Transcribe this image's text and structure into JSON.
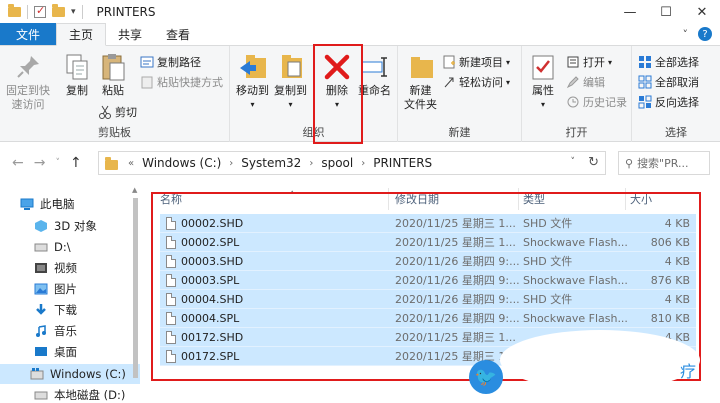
{
  "window": {
    "title": "PRINTERS",
    "controls": {
      "minimize": "—",
      "maximize": "☐",
      "close": "✕"
    }
  },
  "ribbon_tabs": [
    {
      "label": "文件"
    },
    {
      "label": "主页"
    },
    {
      "label": "共享"
    },
    {
      "label": "查看"
    }
  ],
  "ribbon": {
    "clipboard": {
      "label": "剪贴板",
      "pin": "固定到快\n速访问",
      "copy": "复制",
      "paste": "粘贴",
      "copy_path": "复制路径",
      "paste_shortcut": "粘贴快捷方式",
      "cut": "剪切"
    },
    "organize": {
      "label": "组织",
      "move_to": "移动到",
      "copy_to": "复制到",
      "delete": "删除",
      "rename": "重命名"
    },
    "new": {
      "label": "新建",
      "new_folder": "新建\n文件夹",
      "new_item": "新建项目",
      "easy_access": "轻松访问"
    },
    "open": {
      "label": "打开",
      "properties": "属性",
      "open": "打开",
      "edit": "编辑",
      "history": "历史记录"
    },
    "select": {
      "label": "选择",
      "select_all": "全部选择",
      "select_none": "全部取消",
      "invert": "反向选择"
    }
  },
  "address": {
    "prefix": "«",
    "crumbs": [
      "Windows (C:)",
      "System32",
      "spool",
      "PRINTERS"
    ],
    "search_placeholder": "搜索\"PR..."
  },
  "nav_pane": [
    {
      "label": "此电脑",
      "icon": "computer-icon"
    },
    {
      "label": "3D 对象",
      "icon": "cube-icon"
    },
    {
      "label": "D:\\",
      "icon": "drive-icon"
    },
    {
      "label": "视频",
      "icon": "video-icon"
    },
    {
      "label": "图片",
      "icon": "picture-icon"
    },
    {
      "label": "下载",
      "icon": "download-icon"
    },
    {
      "label": "音乐",
      "icon": "music-icon"
    },
    {
      "label": "桌面",
      "icon": "desktop-icon"
    },
    {
      "label": "Windows (C:)",
      "icon": "windows-drive-icon"
    },
    {
      "label": "本地磁盘 (D:)",
      "icon": "drive-icon"
    }
  ],
  "columns": {
    "name": "名称",
    "date": "修改日期",
    "type": "类型",
    "size": "大小"
  },
  "files": [
    {
      "name": "00002.SHD",
      "date": "2020/11/25 星期三 1...",
      "type": "SHD 文件",
      "size": "4 KB"
    },
    {
      "name": "00002.SPL",
      "date": "2020/11/25 星期三 1...",
      "type": "Shockwave Flash...",
      "size": "806 KB"
    },
    {
      "name": "00003.SHD",
      "date": "2020/11/26 星期四 9:...",
      "type": "SHD 文件",
      "size": "4 KB"
    },
    {
      "name": "00003.SPL",
      "date": "2020/11/26 星期四 9:...",
      "type": "Shockwave Flash...",
      "size": "876 KB"
    },
    {
      "name": "00004.SHD",
      "date": "2020/11/26 星期四 9:...",
      "type": "SHD 文件",
      "size": "4 KB"
    },
    {
      "name": "00004.SPL",
      "date": "2020/11/26 星期四 9:...",
      "type": "Shockwave Flash...",
      "size": "810 KB"
    },
    {
      "name": "00172.SHD",
      "date": "2020/11/25 星期三 1...",
      "type": "",
      "size": "4 KB"
    },
    {
      "name": "00172.SPL",
      "date": "2020/11/25 星期三 1...",
      "type": "",
      "size": ""
    }
  ],
  "colors": {
    "accent": "#1979ca",
    "selection": "#cce8ff",
    "highlight": "#e01b1b"
  }
}
